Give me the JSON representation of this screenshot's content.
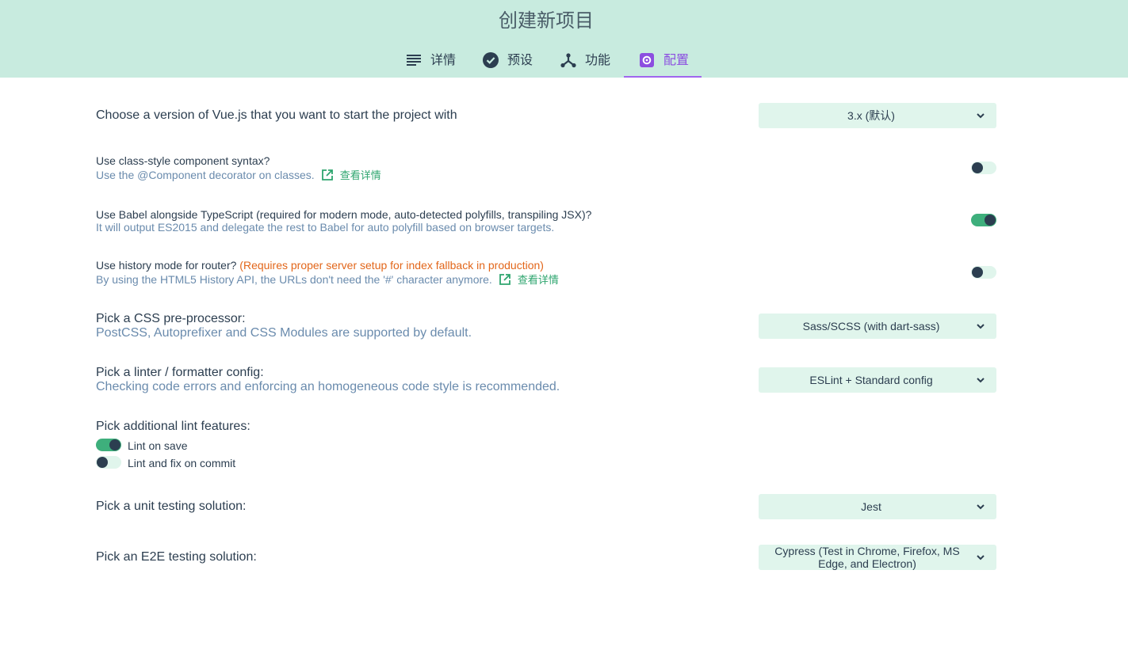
{
  "header": {
    "title": "创建新项目",
    "tabs": [
      {
        "label": "详情",
        "icon": "list-icon"
      },
      {
        "label": "预设",
        "icon": "check-circle-icon"
      },
      {
        "label": "功能",
        "icon": "fork-icon"
      },
      {
        "label": "配置",
        "icon": "settings-icon",
        "active": true
      }
    ]
  },
  "config": {
    "vue_version": {
      "title": "Choose a version of Vue.js that you want to start the project with",
      "value": "3.x (默认)"
    },
    "class_style": {
      "question": "Use class-style component syntax?",
      "desc": "Use the @Component decorator on classes.",
      "link": "查看详情",
      "enabled": false
    },
    "babel": {
      "question": "Use Babel alongside TypeScript (required for modern mode, auto-detected polyfills, transpiling JSX)?",
      "desc": "It will output ES2015 and delegate the rest to Babel for auto polyfill based on browser targets.",
      "enabled": true
    },
    "history": {
      "question": "Use history mode for router?",
      "warning": "(Requires proper server setup for index fallback in production)",
      "desc": "By using the HTML5 History API, the URLs don't need the '#' character anymore.",
      "link": "查看详情",
      "enabled": false
    },
    "css": {
      "title": "Pick a CSS pre-processor:",
      "desc": "PostCSS, Autoprefixer and CSS Modules are supported by default.",
      "value": "Sass/SCSS (with dart-sass)"
    },
    "linter": {
      "title": "Pick a linter / formatter config:",
      "desc": "Checking code errors and enforcing an homogeneous code style is recommended.",
      "value": "ESLint + Standard config"
    },
    "lint_features": {
      "title": "Pick additional lint features:",
      "options": [
        {
          "label": "Lint on save",
          "enabled": true
        },
        {
          "label": "Lint and fix on commit",
          "enabled": false
        }
      ]
    },
    "unit": {
      "title": "Pick a unit testing solution:",
      "value": "Jest"
    },
    "e2e": {
      "title": "Pick an E2E testing solution:",
      "value": "Cypress (Test in Chrome, Firefox, MS Edge, and Electron)"
    }
  },
  "colors": {
    "header_bg": "#c8ebdf",
    "accent_purple": "#8c4ee0",
    "toggle_on": "#3eaf7c",
    "select_bg": "#e0f5ec",
    "link_green": "#2ea56f",
    "warning_orange": "#e2661a"
  }
}
